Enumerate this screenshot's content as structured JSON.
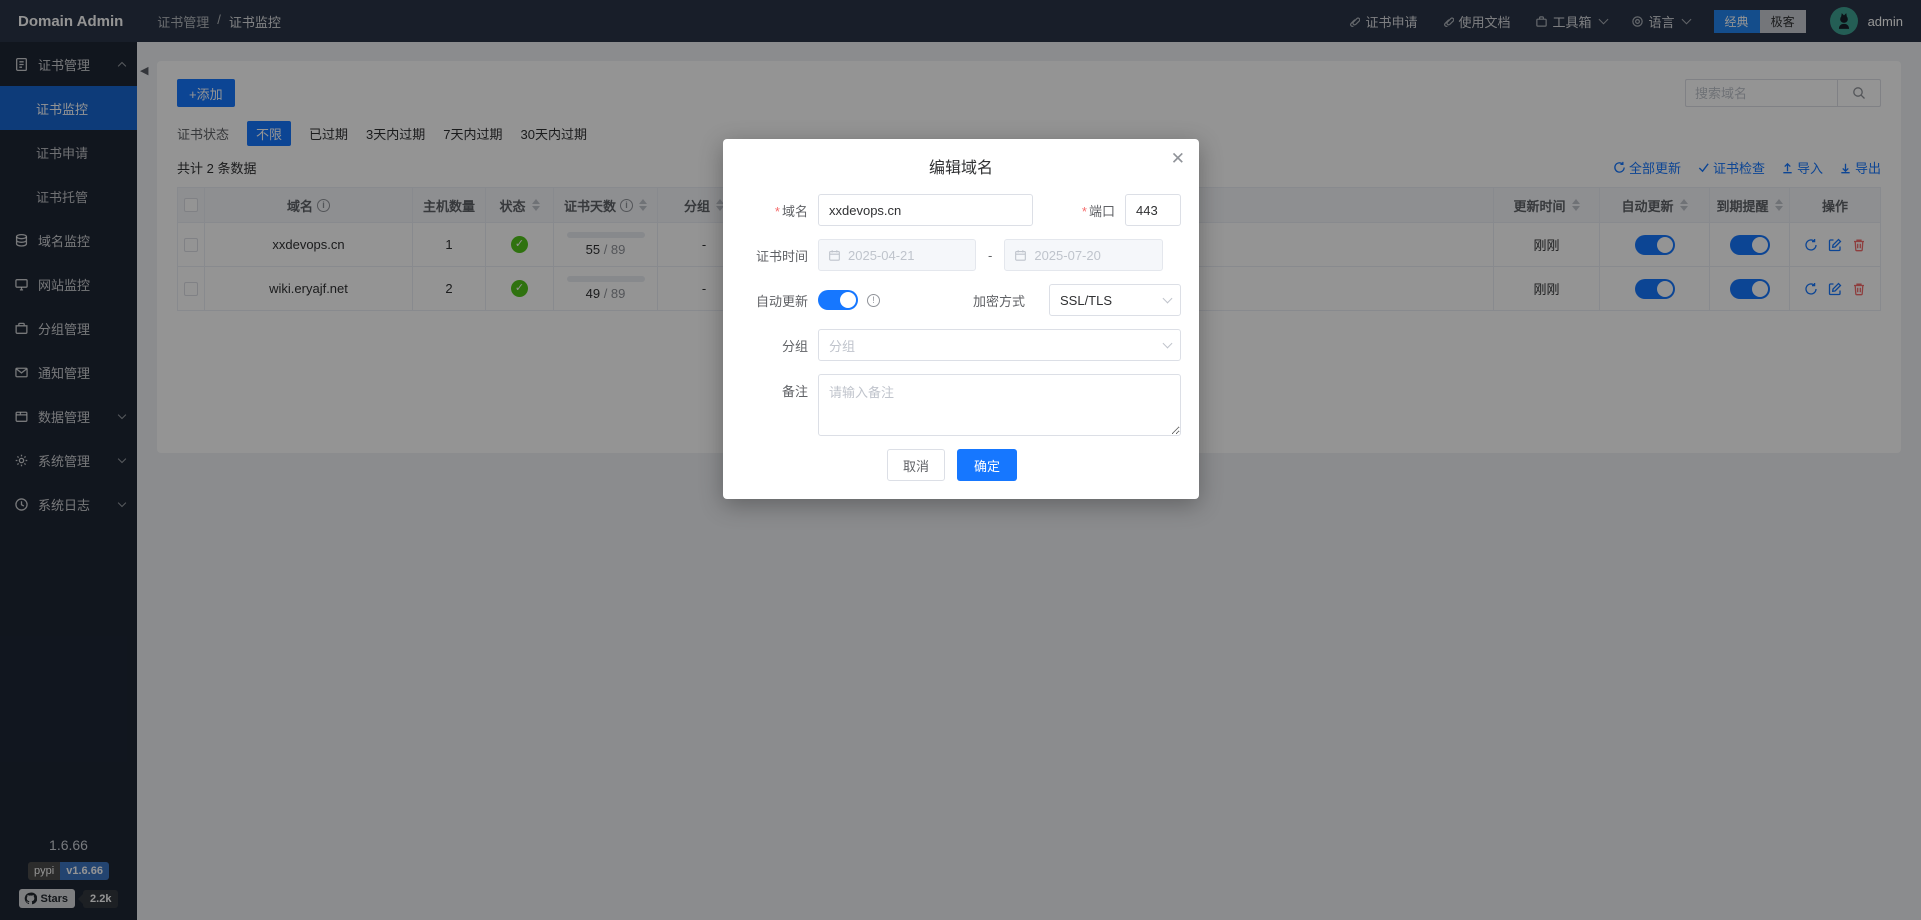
{
  "colors": {
    "accent": "#1677ff",
    "green": "#52c41a",
    "red": "#f56c6c",
    "sidebar_active": "#1766d1",
    "topbar_bg": "#2a3547",
    "sidebar_bg": "#1e2635"
  },
  "topbar": {
    "logo": "Domain Admin",
    "breadcrumb": {
      "parent": "证书管理",
      "separator": "/",
      "current": "证书监控"
    },
    "links": {
      "cert_apply": "证书申请",
      "docs": "使用文档",
      "toolbox": "工具箱",
      "language": "语言"
    },
    "theme": {
      "classic": "经典",
      "geek": "极客"
    },
    "username": "admin"
  },
  "sidebar": {
    "items": {
      "cert_mgmt": "证书管理",
      "cert_monitor": "证书监控",
      "cert_apply": "证书申请",
      "cert_host": "证书托管",
      "domain_monitor": "域名监控",
      "site_monitor": "网站监控",
      "group_mgmt": "分组管理",
      "notify_mgmt": "通知管理",
      "data_mgmt": "数据管理",
      "sys_mgmt": "系统管理",
      "sys_log": "系统日志"
    },
    "version": "1.6.66",
    "pypi_label": "pypi",
    "pypi_version": "v1.6.66",
    "stars_label": "Stars",
    "stars_count": "2.2k"
  },
  "toolbar": {
    "add_label": "+添加",
    "search_placeholder": "搜索域名"
  },
  "filters": {
    "label": "证书状态",
    "active": "不限",
    "opt_expired": "已过期",
    "opt_3d": "3天内过期",
    "opt_7d": "7天内过期",
    "opt_30d": "30天内过期"
  },
  "summary": {
    "total_text": "共计 2 条数据"
  },
  "bulk_actions": {
    "update_all": "全部更新",
    "cert_check": "证书检查",
    "import": "导入",
    "export": "导出"
  },
  "table": {
    "columns": {
      "domain": "域名",
      "hosts": "主机数量",
      "status": "状态",
      "cert_days": "证书天数",
      "group": "分组",
      "updated": "更新时间",
      "auto_update": "自动更新",
      "expire_notify": "到期提醒",
      "actions": "操作"
    },
    "rows": [
      {
        "domain": "xxdevops.cn",
        "hosts": "1",
        "days_used": "55",
        "days_rest": "/ 89",
        "group": "-",
        "updated": "刚刚"
      },
      {
        "domain": "wiki.eryajf.net",
        "hosts": "2",
        "days_used": "49",
        "days_rest": "/ 89",
        "group": "-",
        "updated": "刚刚"
      }
    ]
  },
  "modal": {
    "title": "编辑域名",
    "required_mark": "*",
    "domain_label": "域名",
    "domain_value": "xxdevops.cn",
    "port_label": "端口",
    "port_value": "443",
    "cert_time_label": "证书时间",
    "cert_start": "2025-04-21",
    "range_separator": "-",
    "cert_end": "2025-07-20",
    "auto_update_label": "自动更新",
    "encryption_label": "加密方式",
    "encryption_value": "SSL/TLS",
    "group_label": "分组",
    "group_placeholder": "分组",
    "remark_label": "备注",
    "remark_placeholder": "请输入备注",
    "cancel": "取消",
    "ok": "确定"
  }
}
